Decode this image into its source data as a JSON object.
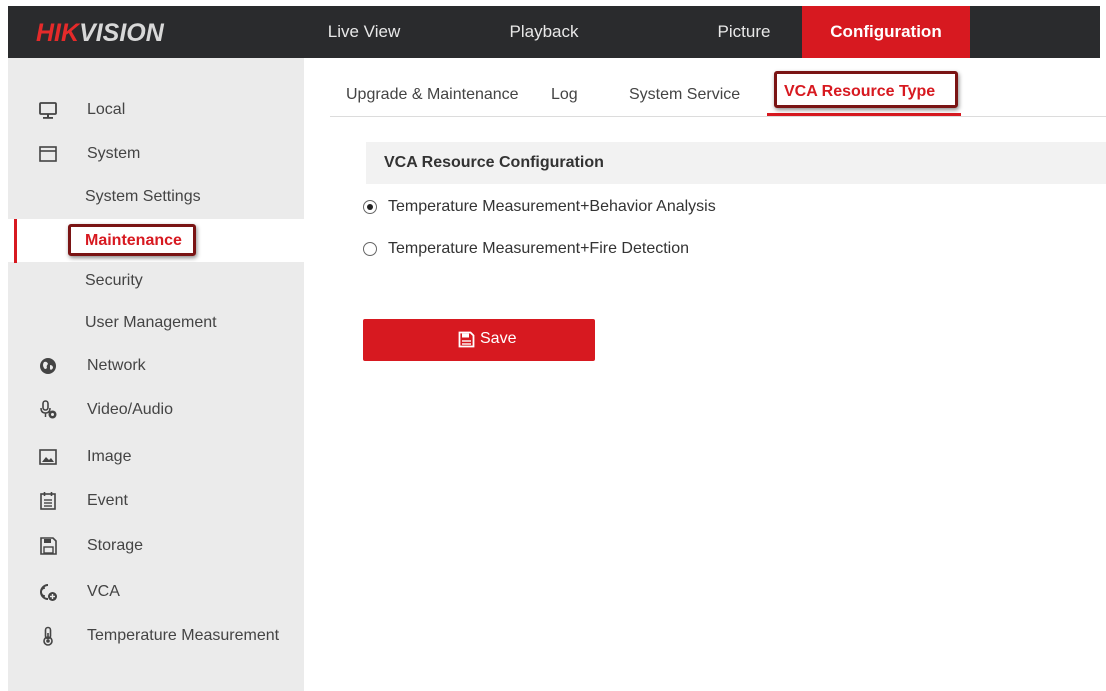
{
  "brand": {
    "part1": "HIK",
    "part2": "VISION"
  },
  "nav": {
    "items": [
      "Live View",
      "Playback",
      "Picture",
      "Configuration"
    ],
    "active": "Configuration"
  },
  "sidebar": {
    "sections": [
      {
        "label": "Local",
        "icon": "monitor-icon"
      },
      {
        "label": "System",
        "icon": "window-icon"
      },
      {
        "label": "Network",
        "icon": "globe-icon"
      },
      {
        "label": "Video/Audio",
        "icon": "microphone-icon"
      },
      {
        "label": "Image",
        "icon": "image-icon"
      },
      {
        "label": "Event",
        "icon": "calendar-icon"
      },
      {
        "label": "Storage",
        "icon": "floppy-disk-icon"
      },
      {
        "label": "VCA",
        "icon": "vca-icon"
      },
      {
        "label": "Temperature Measurement",
        "icon": "thermometer-icon"
      }
    ],
    "system_subitems": [
      "System Settings",
      "Maintenance",
      "Security",
      "User Management"
    ],
    "active_subitem": "Maintenance"
  },
  "tabs": {
    "items": [
      "Upgrade & Maintenance",
      "Log",
      "System Service",
      "VCA Resource Type"
    ],
    "active": "VCA Resource Type"
  },
  "content": {
    "section_title": "VCA Resource Configuration",
    "options": [
      {
        "label": "Temperature Measurement+Behavior Analysis",
        "checked": true
      },
      {
        "label": "Temperature Measurement+Fire Detection",
        "checked": false
      }
    ],
    "save_label": "Save"
  },
  "colors": {
    "accent": "#d71920",
    "topbar": "#2a2b2d",
    "sidebar_bg": "#ebebeb",
    "highlight_box": "#7a1414"
  }
}
